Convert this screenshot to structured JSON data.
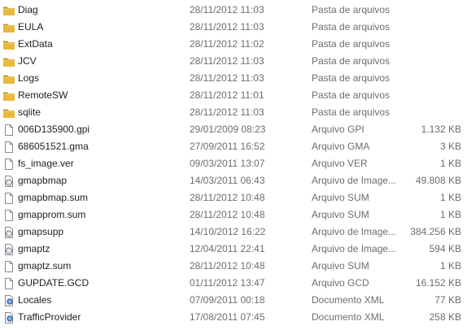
{
  "colors": {
    "folder": "#e8b93a",
    "folder_dark": "#c8941c",
    "text": "#1e1e1e",
    "muted": "#6d6d6d"
  },
  "files": [
    {
      "name": "Diag",
      "date": "28/11/2012 11:03",
      "type": "Pasta de arquivos",
      "size": "",
      "icon": "folder-icon"
    },
    {
      "name": "EULA",
      "date": "28/11/2012 11:03",
      "type": "Pasta de arquivos",
      "size": "",
      "icon": "folder-icon"
    },
    {
      "name": "ExtData",
      "date": "28/11/2012 11:02",
      "type": "Pasta de arquivos",
      "size": "",
      "icon": "folder-icon"
    },
    {
      "name": "JCV",
      "date": "28/11/2012 11:03",
      "type": "Pasta de arquivos",
      "size": "",
      "icon": "folder-icon"
    },
    {
      "name": "Logs",
      "date": "28/11/2012 11:03",
      "type": "Pasta de arquivos",
      "size": "",
      "icon": "folder-icon"
    },
    {
      "name": "RemoteSW",
      "date": "28/11/2012 11:01",
      "type": "Pasta de arquivos",
      "size": "",
      "icon": "folder-icon"
    },
    {
      "name": "sqlite",
      "date": "28/11/2012 11:03",
      "type": "Pasta de arquivos",
      "size": "",
      "icon": "folder-icon"
    },
    {
      "name": "006D135900.gpi",
      "date": "29/01/2009 08:23",
      "type": "Arquivo GPI",
      "size": "1.132 KB",
      "icon": "file-icon"
    },
    {
      "name": "686051521.gma",
      "date": "27/09/2011 16:52",
      "type": "Arquivo GMA",
      "size": "3 KB",
      "icon": "file-icon"
    },
    {
      "name": "fs_image.ver",
      "date": "09/03/2011 13:07",
      "type": "Arquivo VER",
      "size": "1 KB",
      "icon": "file-icon"
    },
    {
      "name": "gmapbmap",
      "date": "14/03/2011 06:43",
      "type": "Arquivo de Image...",
      "size": "49.808 KB",
      "icon": "disc-image-icon"
    },
    {
      "name": "gmapbmap.sum",
      "date": "28/11/2012 10:48",
      "type": "Arquivo SUM",
      "size": "1 KB",
      "icon": "file-icon"
    },
    {
      "name": "gmapprom.sum",
      "date": "28/11/2012 10:48",
      "type": "Arquivo SUM",
      "size": "1 KB",
      "icon": "file-icon"
    },
    {
      "name": "gmapsupp",
      "date": "14/10/2012 16:22",
      "type": "Arquivo de Image...",
      "size": "384.256 KB",
      "icon": "disc-image-icon"
    },
    {
      "name": "gmaptz",
      "date": "12/04/2011 22:41",
      "type": "Arquivo de Image...",
      "size": "594 KB",
      "icon": "disc-image-icon"
    },
    {
      "name": "gmaptz.sum",
      "date": "28/11/2012 10:48",
      "type": "Arquivo SUM",
      "size": "1 KB",
      "icon": "file-icon"
    },
    {
      "name": "GUPDATE.GCD",
      "date": "01/11/2012 13:47",
      "type": "Arquivo GCD",
      "size": "16.152 KB",
      "icon": "file-icon"
    },
    {
      "name": "Locales",
      "date": "07/09/2011 00:18",
      "type": "Documento XML",
      "size": "77 KB",
      "icon": "xml-document-icon"
    },
    {
      "name": "TrafficProvider",
      "date": "17/08/2011 07:45",
      "type": "Documento XML",
      "size": "258 KB",
      "icon": "xml-document-icon"
    }
  ]
}
